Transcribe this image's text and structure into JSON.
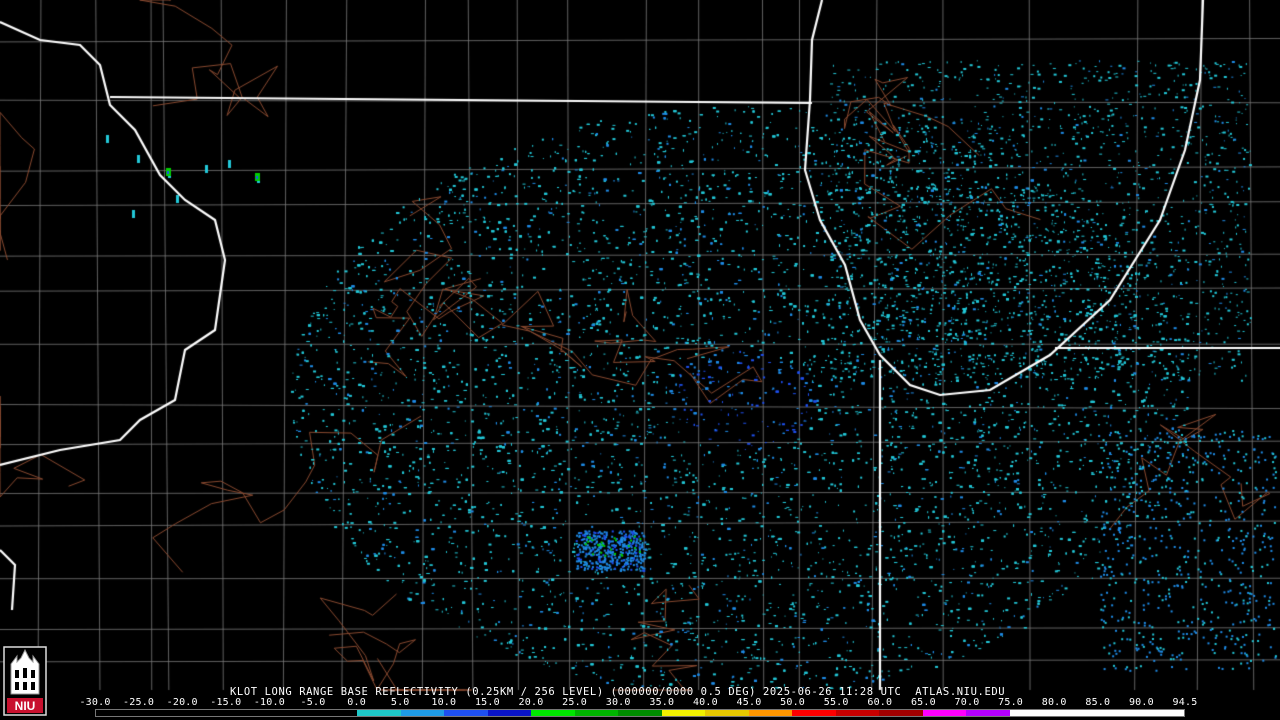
{
  "product": {
    "caption": "KLOT LONG RANGE BASE REFLECTIVITY (0.25KM / 256 LEVEL) (000000/0000 0.5 DEG) 2025-06-26 11:28 UTC  ATLAS.NIU.EDU"
  },
  "logo": {
    "text": "NIU"
  },
  "colorscale": {
    "labels": [
      "-30.0",
      "-25.0",
      "-20.0",
      "-15.0",
      "-10.0",
      "-5.0",
      "0.0",
      "5.0",
      "10.0",
      "15.0",
      "20.0",
      "25.0",
      "30.0",
      "35.0",
      "40.0",
      "45.0",
      "50.0",
      "55.0",
      "60.0",
      "65.0",
      "70.0",
      "75.0",
      "80.0",
      "85.0",
      "90.0",
      "94.5"
    ],
    "colors": [
      "#000000",
      "#000000",
      "#000000",
      "#000000",
      "#000000",
      "#000000",
      "#1ec8c8",
      "#1e9be6",
      "#1e50f0",
      "#0a14c8",
      "#00e600",
      "#00b400",
      "#008c00",
      "#f0f000",
      "#e6c800",
      "#ff9600",
      "#ff0000",
      "#c80000",
      "#a00000",
      "#ff00ff",
      "#b400ff",
      "#ffffff",
      "#ffffff",
      "#ffffff",
      "#ffffff"
    ]
  },
  "map": {
    "radar_site": "KLOT",
    "colors": {
      "state_border": "#ffffff",
      "county_border": "#7a7a7a",
      "highway": "#8a4a30",
      "echo_light": "#22c8d8",
      "echo_mid": "#1e8be6",
      "echo_strong": "#1e50f0",
      "echo_green": "#00d000"
    }
  }
}
